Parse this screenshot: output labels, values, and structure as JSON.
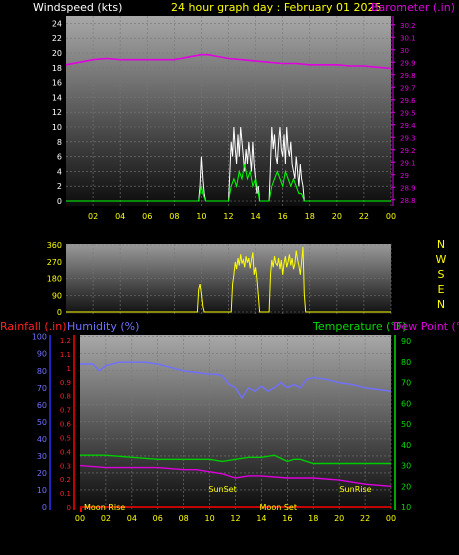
{
  "header": {
    "title": "24 hour graph day : February 01 2025",
    "wind_label": "Windspeed (kts)",
    "baro_label": "Barometer (.in)"
  },
  "colors": {
    "wind": "#00ff00",
    "gust": "#ffffff",
    "barometer": "#e000e0",
    "direction": "#ffff00",
    "humidity": "#7070ff",
    "temperature": "#00cc00",
    "dewpoint": "#dd00dd",
    "rainfall": "#ff0000",
    "title": "#ffff00"
  },
  "chart_data": [
    {
      "type": "line",
      "name": "wind-barometer",
      "x_ticks": [
        "02",
        "04",
        "06",
        "08",
        "10",
        "12",
        "14",
        "16",
        "18",
        "20",
        "22",
        "00"
      ],
      "y_left": {
        "label": "Windspeed (kts)",
        "ticks": [
          "0",
          "2",
          "4",
          "6",
          "8",
          "10",
          "12",
          "14",
          "16",
          "18",
          "20",
          "22",
          "24"
        ],
        "ylim": [
          0,
          25
        ]
      },
      "y_right": {
        "label": "Barometer (.in)",
        "ticks": [
          "28.8",
          "28.9",
          "29",
          "29.1",
          "29.2",
          "29.3",
          "29.4",
          "29.5",
          "29.6",
          "29.7",
          "29.8",
          "29.9",
          "30",
          "30.1",
          "30.2"
        ],
        "ylim": [
          28.75,
          30.27
        ]
      },
      "series": [
        {
          "key": "barometer",
          "axis": "right",
          "x": [
            0,
            1,
            2,
            3,
            4,
            5,
            6,
            7,
            8,
            9,
            10,
            10.5,
            11,
            12,
            13,
            14,
            15,
            16,
            17,
            18,
            19,
            20,
            21,
            22,
            23,
            24
          ],
          "y": [
            29.88,
            29.9,
            29.92,
            29.93,
            29.92,
            29.92,
            29.92,
            29.92,
            29.92,
            29.94,
            29.96,
            29.96,
            29.95,
            29.93,
            29.92,
            29.91,
            29.9,
            29.89,
            29.89,
            29.88,
            29.88,
            29.88,
            29.87,
            29.87,
            29.86,
            29.85
          ]
        },
        {
          "key": "gust",
          "axis": "left",
          "x": [
            0,
            9.8,
            9.9,
            10.0,
            10.1,
            10.2,
            10.3,
            12.0,
            12.1,
            12.2,
            12.3,
            12.4,
            12.5,
            12.6,
            12.7,
            12.8,
            12.9,
            13.0,
            13.1,
            13.2,
            13.3,
            13.4,
            13.5,
            13.6,
            13.7,
            13.8,
            13.9,
            14.0,
            14.1,
            14.2,
            14.3,
            14.5,
            15.0,
            15.1,
            15.2,
            15.3,
            15.4,
            15.5,
            15.6,
            15.7,
            15.8,
            15.9,
            16.0,
            16.1,
            16.2,
            16.3,
            16.4,
            16.5,
            16.6,
            16.7,
            16.8,
            16.9,
            17.0,
            17.1,
            17.2,
            17.3,
            17.4,
            17.5,
            17.6,
            24
          ],
          "y": [
            0,
            0,
            2,
            6,
            3,
            1,
            0,
            0,
            4,
            8,
            6,
            10,
            7,
            5,
            9,
            6,
            10,
            8,
            6,
            4,
            7,
            5,
            8,
            6,
            4,
            8,
            5,
            3,
            1,
            2,
            0,
            0,
            0,
            5,
            10,
            7,
            9,
            6,
            5,
            8,
            10,
            7,
            6,
            9,
            5,
            10,
            7,
            6,
            8,
            5,
            4,
            3,
            6,
            4,
            2,
            5,
            3,
            2,
            0,
            0
          ]
        },
        {
          "key": "wind",
          "axis": "left",
          "x": [
            0,
            9.8,
            9.9,
            10.0,
            10.1,
            10.3,
            12.0,
            12.2,
            12.4,
            12.6,
            12.8,
            13.0,
            13.2,
            13.4,
            13.6,
            13.8,
            14.0,
            14.2,
            14.3,
            15.0,
            15.2,
            15.4,
            15.6,
            15.8,
            16.0,
            16.2,
            16.4,
            16.6,
            16.8,
            17.0,
            17.2,
            17.4,
            17.6,
            24
          ],
          "y": [
            0,
            0,
            1,
            2,
            1,
            0,
            0,
            2,
            3,
            2,
            4,
            3,
            5,
            3,
            4,
            2,
            3,
            1,
            0,
            0,
            2,
            3,
            4,
            3,
            2,
            4,
            3,
            2,
            3,
            2,
            1,
            1,
            0,
            0
          ]
        }
      ]
    },
    {
      "type": "line",
      "name": "wind-direction",
      "x_ticks": [],
      "y_left": {
        "ticks": [
          "0",
          "90",
          "180",
          "270",
          "360"
        ],
        "ylim": [
          0,
          360
        ]
      },
      "compass": [
        "N",
        "W",
        "S",
        "E",
        "N"
      ],
      "series": [
        {
          "key": "direction",
          "axis": "left",
          "x": [
            0,
            9.7,
            9.8,
            9.9,
            10.0,
            10.1,
            10.2,
            12.2,
            12.3,
            12.4,
            12.5,
            12.6,
            12.7,
            12.8,
            12.9,
            13.0,
            13.1,
            13.2,
            13.3,
            13.4,
            13.5,
            13.6,
            13.7,
            13.8,
            13.9,
            14.0,
            14.1,
            14.2,
            14.3,
            15.0,
            15.1,
            15.2,
            15.3,
            15.4,
            15.5,
            15.6,
            15.7,
            15.8,
            15.9,
            16.0,
            16.1,
            16.2,
            16.3,
            16.4,
            16.5,
            16.6,
            16.7,
            16.8,
            16.9,
            17.0,
            17.1,
            17.2,
            17.3,
            17.4,
            17.5,
            17.6,
            17.7,
            24
          ],
          "y": [
            0,
            0,
            120,
            150,
            100,
            30,
            0,
            0,
            150,
            200,
            270,
            230,
            290,
            250,
            310,
            260,
            280,
            240,
            300,
            265,
            290,
            235,
            280,
            320,
            200,
            240,
            180,
            90,
            0,
            0,
            200,
            280,
            240,
            300,
            260,
            250,
            290,
            230,
            280,
            200,
            260,
            300,
            240,
            270,
            310,
            250,
            290,
            230,
            260,
            330,
            280,
            250,
            200,
            270,
            350,
            100,
            0,
            0
          ]
        }
      ]
    },
    {
      "type": "line",
      "name": "humidity-temperature",
      "x_ticks": [
        "02",
        "04",
        "06",
        "08",
        "10",
        "12",
        "14",
        "16",
        "18",
        "20",
        "22",
        "00"
      ],
      "y_left": {
        "label": "Humidity (%)",
        "ticks": [
          "0",
          "10",
          "20",
          "30",
          "40",
          "50",
          "60",
          "70",
          "80",
          "90",
          "100"
        ],
        "ylim": [
          0,
          101
        ]
      },
      "y_rain": {
        "label": "Rainfall (.in)",
        "ticks": [
          "0",
          "0.1",
          "0.2",
          "0.3",
          "0.4",
          "0.5",
          "0.6",
          "0.7",
          "0.8",
          "0.9",
          "1",
          "1.1",
          "1.2"
        ],
        "ylim": [
          0,
          1.2
        ]
      },
      "y_right": {
        "label": "Temperature (°F)",
        "ticks": [
          "10",
          "20",
          "30",
          "40",
          "50",
          "60",
          "70",
          "80",
          "90"
        ],
        "ylim": [
          10,
          93
        ]
      },
      "dewpoint_label": "Dew Point (°F)",
      "annotations": [
        {
          "text": "Moon Rise",
          "x": 0.2,
          "pos": "bottom"
        },
        {
          "text": "SunSet",
          "x": 11,
          "pos": "upper"
        },
        {
          "text": "Moon Set",
          "x": 15.3,
          "pos": "bottom"
        },
        {
          "text": "SunRise",
          "x": 22.5,
          "pos": "upper"
        }
      ],
      "bottom_ticks": [
        "00",
        "02",
        "04",
        "06",
        "08",
        "10",
        "12",
        "14",
        "16",
        "18",
        "20",
        "22",
        "00"
      ],
      "series": [
        {
          "key": "humidity",
          "axis": "left",
          "x": [
            0,
            1,
            1.5,
            2,
            3,
            4,
            5,
            6,
            7,
            8,
            9,
            10,
            10.5,
            11,
            11.5,
            12,
            12.5,
            13,
            13.5,
            14,
            14.5,
            15,
            15.5,
            16,
            16.5,
            17,
            17.5,
            18,
            19,
            20,
            21,
            22,
            23,
            24
          ],
          "y": [
            84,
            84,
            80,
            83,
            85,
            85,
            85,
            84,
            82,
            80,
            79,
            78,
            78,
            77,
            72,
            70,
            64,
            70,
            68,
            71,
            68,
            70,
            73,
            70,
            72,
            70,
            75,
            76,
            75,
            73,
            72,
            70,
            69,
            68
          ]
        },
        {
          "key": "temperature",
          "axis": "right",
          "x": [
            0,
            2,
            4,
            6,
            8,
            10,
            11,
            12,
            13,
            14,
            15,
            16,
            16.5,
            17,
            18,
            20,
            22,
            24
          ],
          "y": [
            35,
            35,
            34,
            33,
            33,
            33,
            32,
            33,
            34,
            34,
            35,
            32,
            33,
            33,
            31,
            31,
            31,
            31
          ]
        },
        {
          "key": "dewpoint",
          "axis": "right",
          "x": [
            0,
            2,
            4,
            6,
            8,
            9,
            10,
            11,
            12,
            13,
            14,
            16,
            18,
            20,
            22,
            24
          ],
          "y": [
            30,
            29,
            29,
            29,
            28,
            28,
            27,
            26,
            24,
            25,
            25,
            24,
            24,
            23,
            21,
            20
          ]
        },
        {
          "key": "rainfall",
          "axis": "rain",
          "x": [
            0,
            24
          ],
          "y": [
            0,
            0
          ]
        }
      ]
    }
  ]
}
